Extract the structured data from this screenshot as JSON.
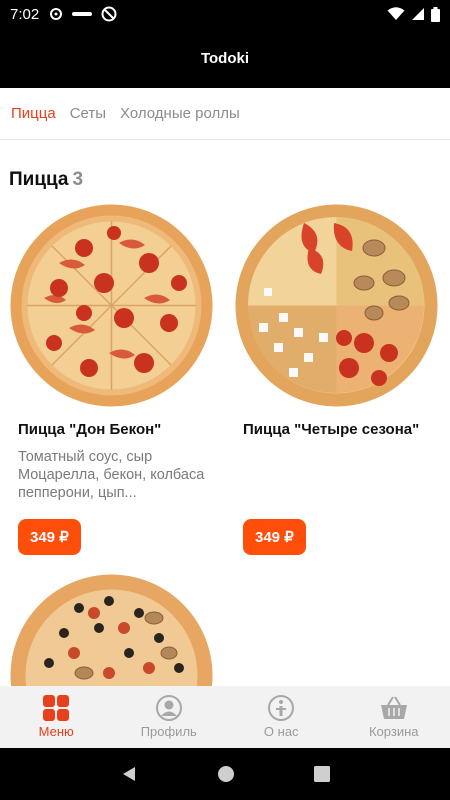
{
  "status": {
    "time": "7:02"
  },
  "app": {
    "title": "Todoki"
  },
  "tabs": [
    {
      "label": "Пицца",
      "active": true
    },
    {
      "label": "Сеты",
      "active": false
    },
    {
      "label": "Холодные роллы",
      "active": false
    }
  ],
  "section": {
    "title": "Пицца",
    "count": "3"
  },
  "products": [
    {
      "name": "Пицца \"Дон Бекон\"",
      "description": "Томатный соус, сыр Моцарелла, бекон, колбаса пепперони, цып...",
      "price": "349 ₽",
      "image": "pizza-don-bacon"
    },
    {
      "name": "Пицца \"Четыре сезона\"",
      "description": "",
      "price": "349 ₽",
      "image": "pizza-four-seasons"
    },
    {
      "name": "",
      "description": "",
      "price": "",
      "image": "pizza-olives-mushrooms"
    }
  ],
  "bottom_nav": [
    {
      "label": "Меню",
      "icon": "menu-grid-icon",
      "active": true
    },
    {
      "label": "Профиль",
      "icon": "profile-icon",
      "active": false
    },
    {
      "label": "О нас",
      "icon": "info-icon",
      "active": false
    },
    {
      "label": "Корзина",
      "icon": "basket-icon",
      "active": false
    }
  ],
  "colors": {
    "accent": "#e8401c",
    "price_button": "#ff4d0a",
    "inactive": "#9a9a9a"
  }
}
